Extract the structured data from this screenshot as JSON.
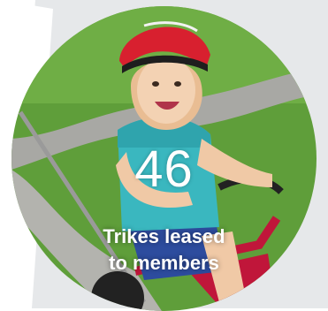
{
  "stat": {
    "number": "46",
    "label_line1": "Trikes leased",
    "label_line2": "to members"
  },
  "colors": {
    "panel": "#e6e8ea",
    "grass": "#5f9e3a",
    "path": "#a8a8a4",
    "helmet": "#d8202f",
    "shirt": "#3ab7bf",
    "trike": "#c0163a",
    "text": "#ffffff"
  }
}
